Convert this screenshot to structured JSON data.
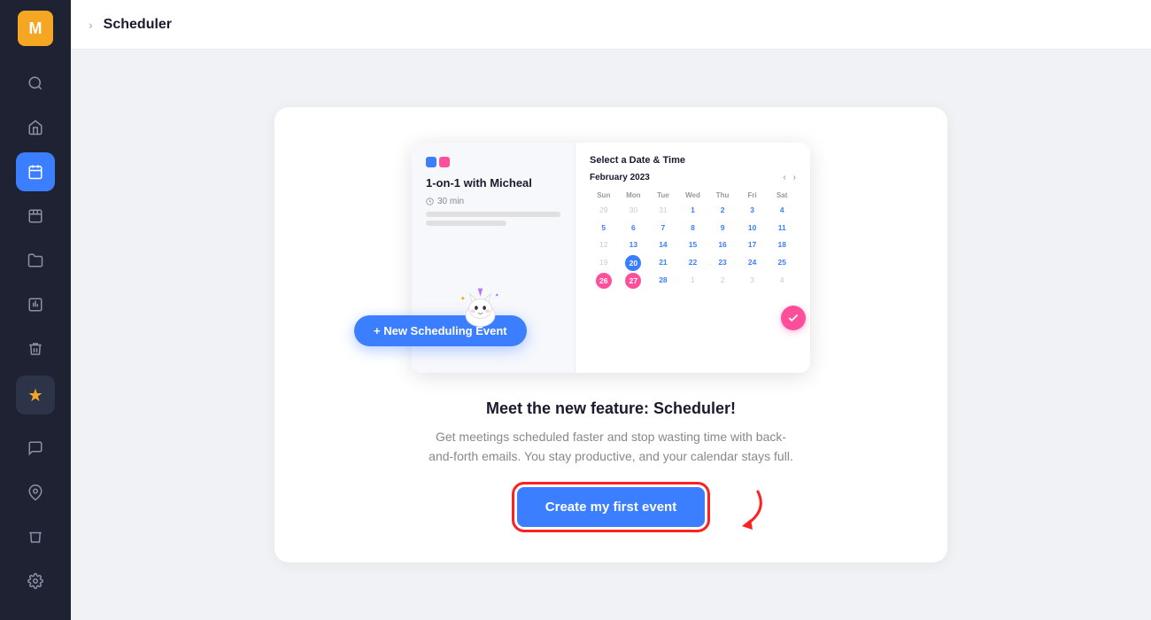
{
  "app": {
    "title": "Scheduler",
    "user_initial": "M"
  },
  "sidebar": {
    "items": [
      {
        "icon": "🔍",
        "name": "search",
        "active": false
      },
      {
        "icon": "🏠",
        "name": "home",
        "active": false
      },
      {
        "icon": "📋",
        "name": "scheduler",
        "active": true
      },
      {
        "icon": "📅",
        "name": "calendar",
        "active": false
      },
      {
        "icon": "📁",
        "name": "folder",
        "active": false
      },
      {
        "icon": "📊",
        "name": "reports",
        "active": false
      },
      {
        "icon": "🗑",
        "name": "trash",
        "active": false
      }
    ],
    "bottom_items": [
      {
        "icon": "💬",
        "name": "chat"
      },
      {
        "icon": "📍",
        "name": "location"
      },
      {
        "icon": "🗑",
        "name": "delete"
      },
      {
        "icon": "⚙",
        "name": "settings"
      }
    ],
    "sparkle_label": "✦"
  },
  "calendar_mockup": {
    "title": "Select a Date & Time",
    "month": "February 2023",
    "event_title": "1-on-1 with Micheal",
    "duration": "30 min",
    "day_headers": [
      "Sun",
      "Mon",
      "Tue",
      "Wed",
      "Thu",
      "Fri",
      "Sat"
    ],
    "days": [
      {
        "label": "29",
        "type": "other"
      },
      {
        "label": "30",
        "type": "other"
      },
      {
        "label": "31",
        "type": "other"
      },
      {
        "label": "1",
        "type": "current"
      },
      {
        "label": "2",
        "type": "highlight"
      },
      {
        "label": "3",
        "type": "highlight"
      },
      {
        "label": "4",
        "type": "highlight"
      },
      {
        "label": "5",
        "type": "highlight"
      },
      {
        "label": "6",
        "type": "highlight"
      },
      {
        "label": "7",
        "type": "highlight"
      },
      {
        "label": "8",
        "type": "highlight"
      },
      {
        "label": "9",
        "type": "highlight"
      },
      {
        "label": "10",
        "type": "highlight"
      },
      {
        "label": "11",
        "type": "highlight"
      },
      {
        "label": "12",
        "type": "current"
      },
      {
        "label": "13",
        "type": "highlight"
      },
      {
        "label": "14",
        "type": "highlight"
      },
      {
        "label": "15",
        "type": "highlight"
      },
      {
        "label": "16",
        "type": "highlight"
      },
      {
        "label": "17",
        "type": "highlight"
      },
      {
        "label": "18",
        "type": "highlight"
      },
      {
        "label": "19",
        "type": "current"
      },
      {
        "label": "20",
        "type": "today"
      },
      {
        "label": "21",
        "type": "highlight"
      },
      {
        "label": "22",
        "type": "highlight"
      },
      {
        "label": "23",
        "type": "highlight"
      },
      {
        "label": "24",
        "type": "highlight"
      },
      {
        "label": "25",
        "type": "highlight"
      },
      {
        "label": "26",
        "type": "selected"
      },
      {
        "label": "27",
        "type": "selected"
      },
      {
        "label": "28",
        "type": "highlight"
      },
      {
        "label": "1",
        "type": "other"
      },
      {
        "label": "2",
        "type": "other"
      },
      {
        "label": "3",
        "type": "other"
      },
      {
        "label": "4",
        "type": "other"
      }
    ]
  },
  "new_event_btn": "+ New Scheduling Event",
  "feature": {
    "title": "Meet the new feature: Scheduler!",
    "description": "Get meetings scheduled faster and stop wasting time with back-and-forth emails. You stay productive, and your calendar stays full."
  },
  "cta": {
    "label": "Create my first event"
  }
}
